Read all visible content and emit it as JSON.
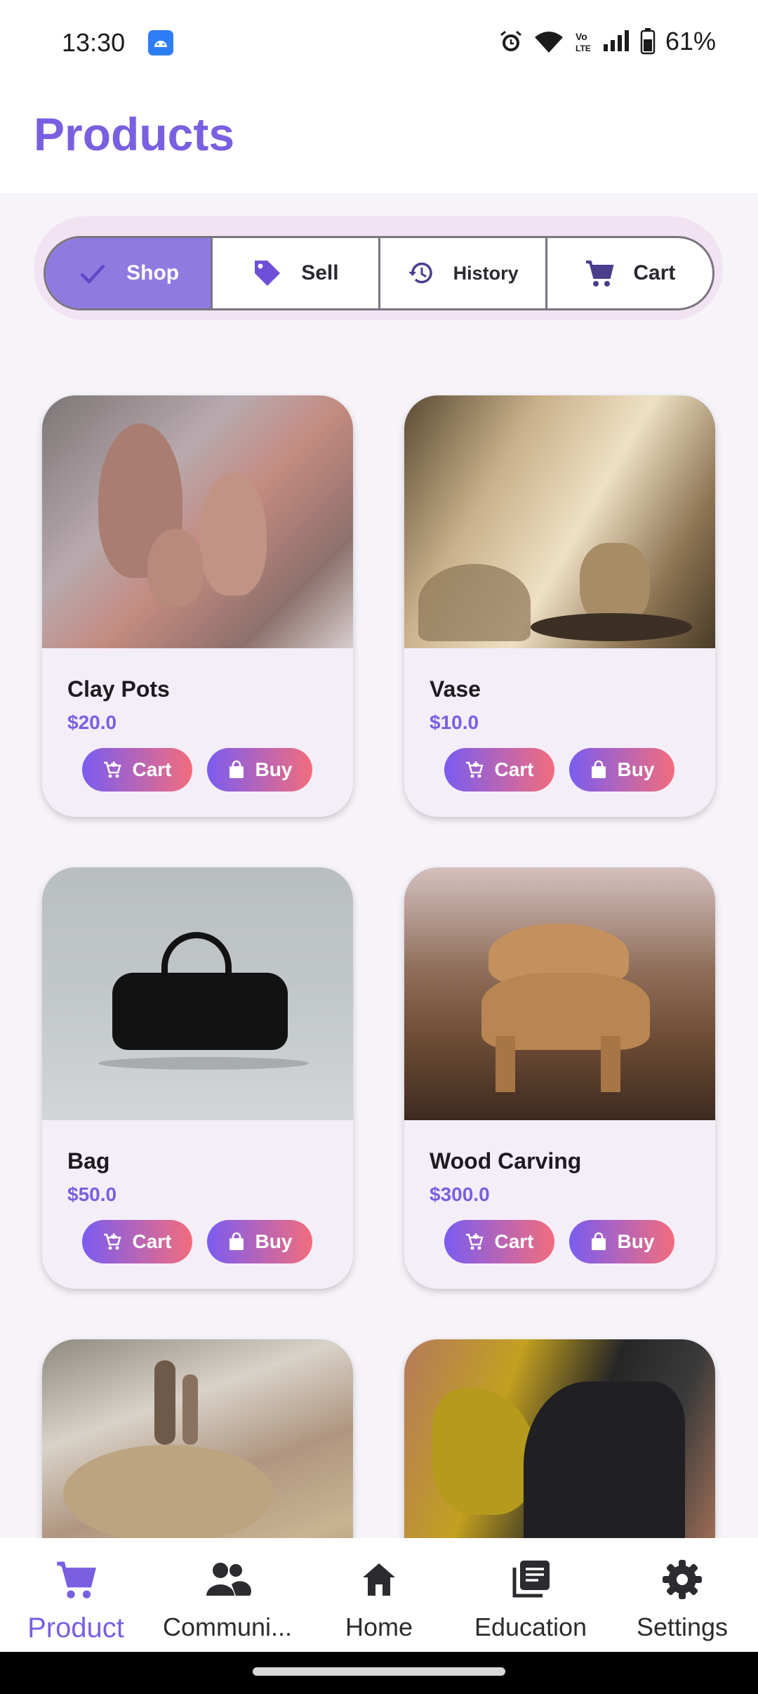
{
  "status_bar": {
    "time": "13:30",
    "battery": "61%"
  },
  "app_bar": {
    "title": "Products"
  },
  "segments": [
    {
      "label": "Shop",
      "icon": "check-icon",
      "active": true
    },
    {
      "label": "Sell",
      "icon": "tag-icon",
      "active": false
    },
    {
      "label": "History",
      "icon": "history-icon",
      "active": false
    },
    {
      "label": "Cart",
      "icon": "cart-icon",
      "active": false
    }
  ],
  "products": [
    {
      "name": "Clay Pots",
      "price": "$20.0",
      "cart_label": "Cart",
      "buy_label": "Buy"
    },
    {
      "name": "Vase",
      "price": "$10.0",
      "cart_label": "Cart",
      "buy_label": "Buy"
    },
    {
      "name": "Bag",
      "price": "$50.0",
      "cart_label": "Cart",
      "buy_label": "Buy"
    },
    {
      "name": "Wood Carving",
      "price": "$300.0",
      "cart_label": "Cart",
      "buy_label": "Buy"
    },
    {
      "name": "",
      "price": "",
      "cart_label": "",
      "buy_label": ""
    },
    {
      "name": "",
      "price": "",
      "cart_label": "",
      "buy_label": ""
    }
  ],
  "bottom_nav": [
    {
      "label": "Product",
      "icon": "cart-icon",
      "active": true
    },
    {
      "label": "Communi...",
      "icon": "people-icon",
      "active": false
    },
    {
      "label": "Home",
      "icon": "home-icon",
      "active": false
    },
    {
      "label": "Education",
      "icon": "library-icon",
      "active": false
    },
    {
      "label": "Settings",
      "icon": "gear-icon",
      "active": false
    }
  ],
  "colors": {
    "accent": "#7a5fe0",
    "segment_active": "#8f7ae0",
    "button_gradient_start": "#7a5cf0",
    "button_gradient_end": "#f26d7d"
  }
}
